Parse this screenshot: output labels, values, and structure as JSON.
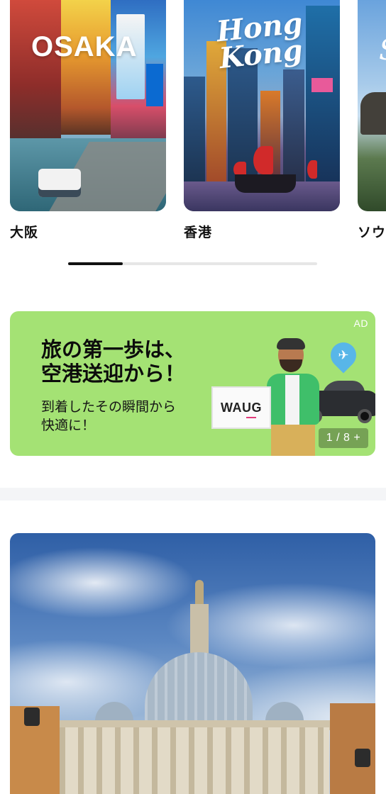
{
  "cities": [
    {
      "logo": "OSAKA",
      "name": "大阪"
    },
    {
      "logo": "Hong\nKong",
      "name": "香港"
    },
    {
      "logo": "S",
      "name": "ソウ"
    }
  ],
  "ad": {
    "label": "AD",
    "title": "旅の第一歩は、\n空港送迎から！",
    "subtitle": "到着したその瞬間から\n快適に！",
    "sign_text": "WAUG",
    "counter": "1 / 8 +",
    "background_color": "#a4e274"
  },
  "scroll_indicator": {
    "position": 0.22
  }
}
